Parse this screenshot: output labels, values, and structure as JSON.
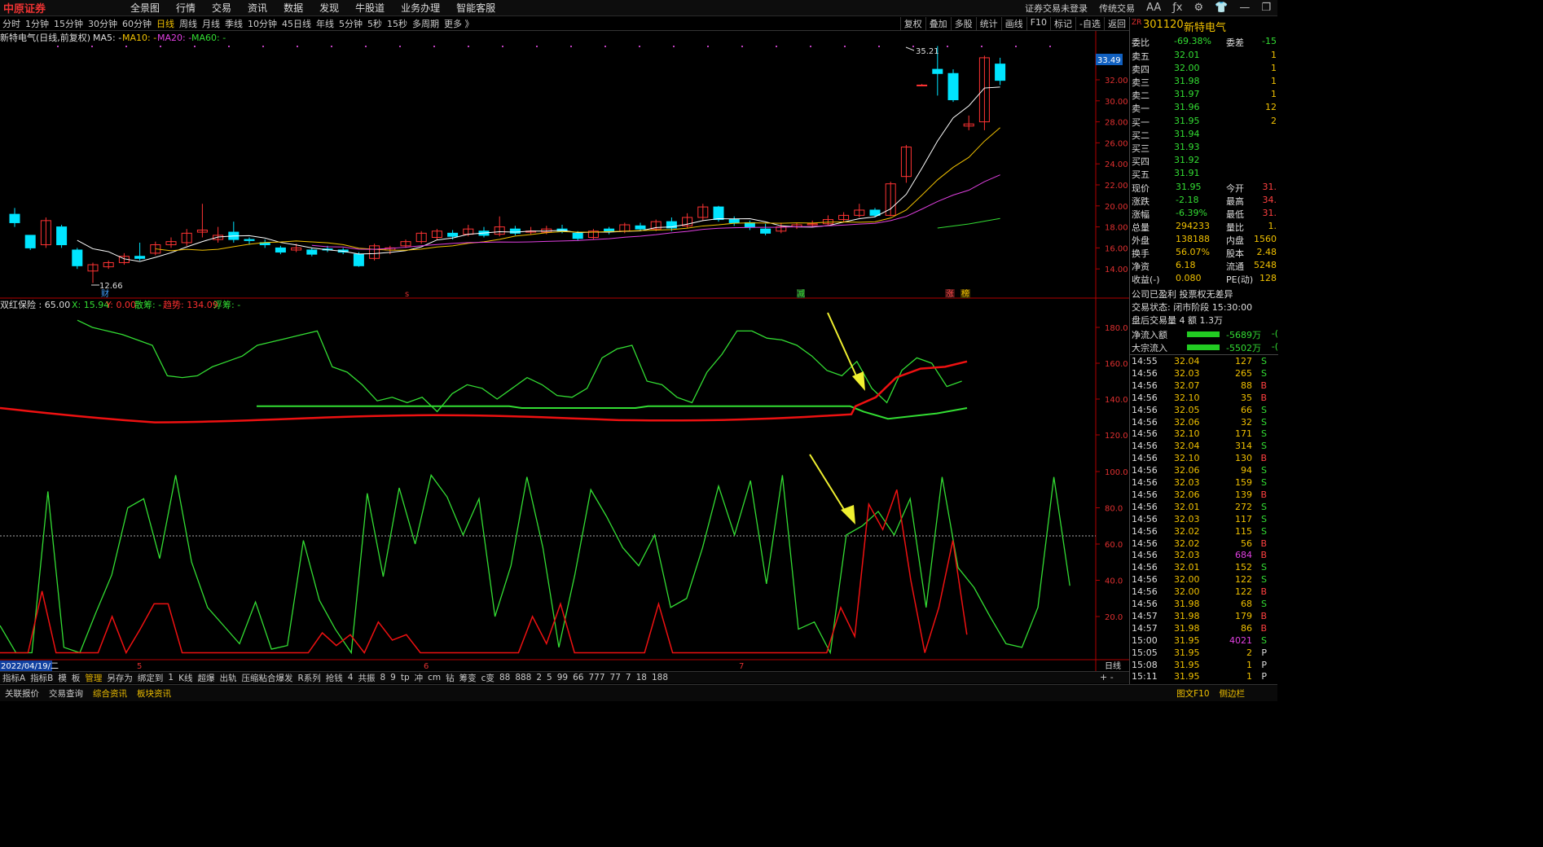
{
  "topbar": {
    "logo": "中原证券",
    "menu": [
      "全景图",
      "行情",
      "交易",
      "资讯",
      "数据",
      "发现",
      "牛股道",
      "业务办理",
      "智能客服"
    ],
    "login_status": "证券交易未登录",
    "trade_mode": "传统交易",
    "font_btn": "AA"
  },
  "periods": {
    "items": [
      "分时",
      "1分钟",
      "15分钟",
      "30分钟",
      "60分钟",
      "日线",
      "周线",
      "月线",
      "季线",
      "10分钟",
      "45日线",
      "年线",
      "5分钟",
      "5秒",
      "15秒",
      "多周期",
      "更多 》"
    ],
    "active": "日线"
  },
  "tools": [
    "复权",
    "叠加",
    "多股",
    "统计",
    "画线",
    "F10",
    "标记",
    "-自选",
    "返回"
  ],
  "main_legend": {
    "title": "新特电气(日线,前复权)",
    "ma5": "MA5: -",
    "ma10": "MA10: -",
    "ma20": "MA20: -",
    "ma60": "MA60: -"
  },
  "price_axis": [
    "32.00",
    "30.00",
    "28.00",
    "26.00",
    "24.00",
    "22.00",
    "20.00",
    "18.00",
    "16.00",
    "14.00"
  ],
  "current_price_tag": "33.49",
  "high_label": "35.21",
  "low_label": "12.66",
  "markers": {
    "cai": "财",
    "s": "s",
    "jian": "减",
    "zhang": "涨",
    "bang": "榜"
  },
  "ind1_legend": {
    "name": "双红保险 : 65.00",
    "x": "X: 15.94",
    "y": "Y: 0.00",
    "sanchou": "散筹: -",
    "trend": "趋势: 134.09",
    "fuchou": "浮筹: -"
  },
  "ind1_axis": [
    "180.0",
    "160.0",
    "140.0",
    "120.0"
  ],
  "ind2_axis": [
    "100.0",
    "80.0",
    "60.0",
    "40.0",
    "20.0"
  ],
  "date_axis": {
    "cursor": "2022/04/19/二",
    "m5": "5",
    "m6": "6",
    "m7": "7",
    "mode": "日线"
  },
  "bottom_tabs": [
    "指标A",
    "指标B",
    "模",
    "板",
    "管理",
    "另存为",
    "绑定到",
    "1",
    "K线",
    "超爆",
    "出轨",
    "压缩粘合爆发",
    "R系列",
    "抢钱",
    "4",
    "共振",
    "8",
    "9",
    "tp",
    "冲",
    "cm",
    "钻",
    "筹变",
    "c变",
    "88",
    "888",
    "2",
    "5",
    "99",
    "66",
    "777",
    "77",
    "7",
    "18",
    "188"
  ],
  "bottom_plus": "+ -",
  "status_items": [
    "关联报价",
    "交易查询",
    "综合资讯",
    "板块资讯"
  ],
  "status_right": [
    "图文F10",
    "侧边栏"
  ],
  "stock": {
    "zr": "ZR",
    "code": "301120",
    "name": "新特电气"
  },
  "weibi": {
    "label": "委比",
    "value": "-69.38%",
    "label2": "委差",
    "value2": "-15"
  },
  "asks": [
    {
      "label": "卖五",
      "price": "32.01",
      "vol": "1"
    },
    {
      "label": "卖四",
      "price": "32.00",
      "vol": "1"
    },
    {
      "label": "卖三",
      "price": "31.98",
      "vol": "1"
    },
    {
      "label": "卖二",
      "price": "31.97",
      "vol": "1"
    },
    {
      "label": "卖一",
      "price": "31.96",
      "vol": "12"
    }
  ],
  "bids": [
    {
      "label": "买一",
      "price": "31.95",
      "vol": "2"
    },
    {
      "label": "买二",
      "price": "31.94",
      "vol": ""
    },
    {
      "label": "买三",
      "price": "31.93",
      "vol": ""
    },
    {
      "label": "买四",
      "price": "31.92",
      "vol": ""
    },
    {
      "label": "买五",
      "price": "31.91",
      "vol": ""
    }
  ],
  "quote": [
    {
      "l1": "现价",
      "v1": "31.95",
      "l2": "今开",
      "v2": "31."
    },
    {
      "l1": "涨跌",
      "v1": "-2.18",
      "l2": "最高",
      "v2": "34."
    },
    {
      "l1": "涨幅",
      "v1": "-6.39%",
      "l2": "最低",
      "v2": "31."
    },
    {
      "l1": "总量",
      "v1": "294233",
      "l2": "量比",
      "v2": "1."
    },
    {
      "l1": "外盘",
      "v1": "138188",
      "l2": "内盘",
      "v2": "1560"
    },
    {
      "l1": "换手",
      "v1": "56.07%",
      "l2": "股本",
      "v2": "2.48"
    },
    {
      "l1": "净资",
      "v1": "6.18",
      "l2": "流通",
      "v2": "5248"
    },
    {
      "l1": "收益(-)",
      "v1": "0.080",
      "l2": "PE(动)",
      "v2": "128"
    }
  ],
  "notes": [
    "公司已盈利 投票权无差异",
    "交易状态: 闭市阶段 15:30:00",
    "盘后交易量 4 额 1.3万"
  ],
  "flows": [
    {
      "label": "净流入额",
      "value": "-5689万",
      "tail": "-("
    },
    {
      "label": "大宗流入",
      "value": "-5502万",
      "tail": "-("
    }
  ],
  "ticks": [
    {
      "t": "14:55",
      "p": "32.04",
      "v": "127",
      "s": "S"
    },
    {
      "t": "14:56",
      "p": "32.03",
      "v": "265",
      "s": "S"
    },
    {
      "t": "14:56",
      "p": "32.07",
      "v": "88",
      "s": "B"
    },
    {
      "t": "14:56",
      "p": "32.10",
      "v": "35",
      "s": "B"
    },
    {
      "t": "14:56",
      "p": "32.05",
      "v": "66",
      "s": "S"
    },
    {
      "t": "14:56",
      "p": "32.06",
      "v": "32",
      "s": "S"
    },
    {
      "t": "14:56",
      "p": "32.10",
      "v": "171",
      "s": "S"
    },
    {
      "t": "14:56",
      "p": "32.04",
      "v": "314",
      "s": "S"
    },
    {
      "t": "14:56",
      "p": "32.10",
      "v": "130",
      "s": "B"
    },
    {
      "t": "14:56",
      "p": "32.06",
      "v": "94",
      "s": "S"
    },
    {
      "t": "14:56",
      "p": "32.03",
      "v": "159",
      "s": "S"
    },
    {
      "t": "14:56",
      "p": "32.06",
      "v": "139",
      "s": "B"
    },
    {
      "t": "14:56",
      "p": "32.01",
      "v": "272",
      "s": "S"
    },
    {
      "t": "14:56",
      "p": "32.03",
      "v": "117",
      "s": "S"
    },
    {
      "t": "14:56",
      "p": "32.02",
      "v": "115",
      "s": "S"
    },
    {
      "t": "14:56",
      "p": "32.02",
      "v": "56",
      "s": "B"
    },
    {
      "t": "14:56",
      "p": "32.03",
      "v": "684",
      "s": "B"
    },
    {
      "t": "14:56",
      "p": "32.01",
      "v": "152",
      "s": "S"
    },
    {
      "t": "14:56",
      "p": "32.00",
      "v": "122",
      "s": "S"
    },
    {
      "t": "14:56",
      "p": "32.00",
      "v": "122",
      "s": "B"
    },
    {
      "t": "14:56",
      "p": "31.98",
      "v": "68",
      "s": "S"
    },
    {
      "t": "14:57",
      "p": "31.98",
      "v": "179",
      "s": "B"
    },
    {
      "t": "14:57",
      "p": "31.98",
      "v": "86",
      "s": "B"
    },
    {
      "t": "15:00",
      "p": "31.95",
      "v": "4021",
      "s": "S"
    },
    {
      "t": "15:05",
      "p": "31.95",
      "v": "2",
      "s": "P"
    },
    {
      "t": "15:08",
      "p": "31.95",
      "v": "1",
      "s": "P"
    },
    {
      "t": "15:11",
      "p": "31.95",
      "v": "1",
      "s": "P"
    }
  ],
  "colors": {
    "up": "#ff3333",
    "down": "#00e5ff",
    "green": "#33dd33",
    "axis": "#c00000",
    "yellow": "#f0c000"
  }
}
